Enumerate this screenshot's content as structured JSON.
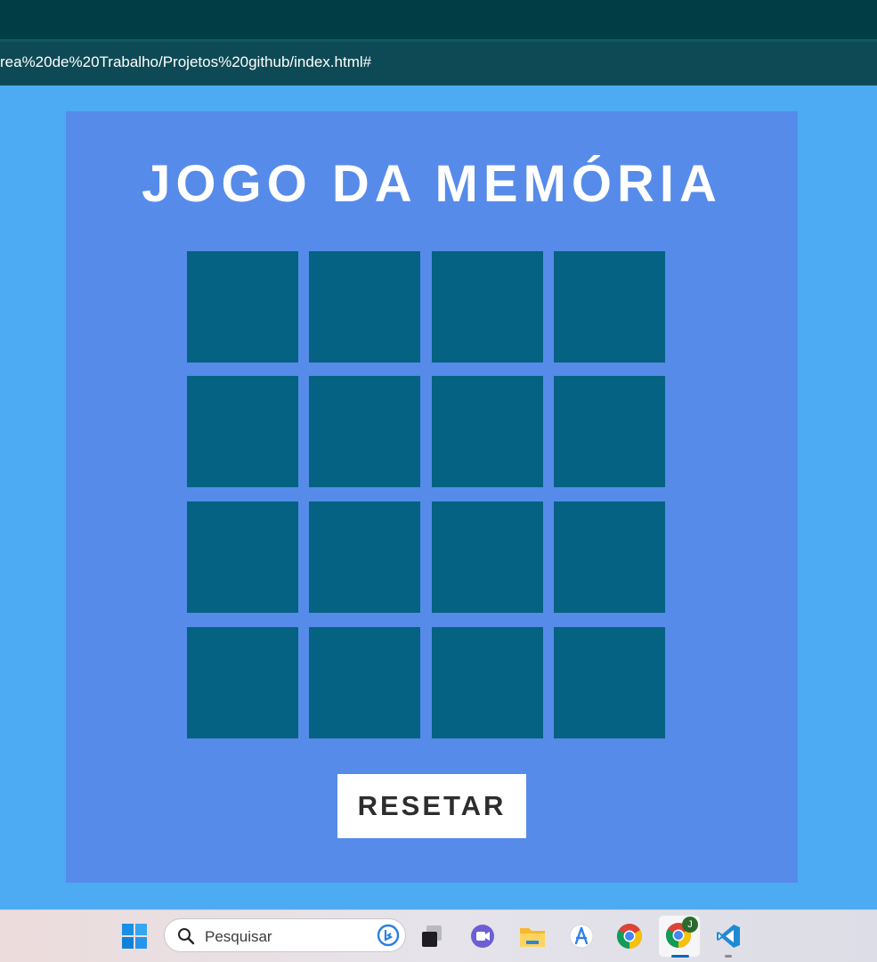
{
  "browser": {
    "url": "rea%20de%20Trabalho/Projetos%20github/index.html#"
  },
  "game": {
    "title": "JOGO DA MEMÓRIA",
    "reset_label": "RESETAR",
    "card_count": 16,
    "colors": {
      "page_background": "#4dabf3",
      "panel": "#568bea",
      "card_back": "#056282",
      "button": "#ffffff"
    }
  },
  "taskbar": {
    "search_placeholder": "Pesquisar",
    "apps": [
      "windows-start-icon",
      "search-icon",
      "bing-icon",
      "task-view-icon",
      "teams-meet-icon",
      "file-explorer-icon",
      "app-store-icon",
      "chrome-icon",
      "chrome-profile-icon",
      "vscode-icon"
    ],
    "chrome_profile_badge": "J"
  }
}
